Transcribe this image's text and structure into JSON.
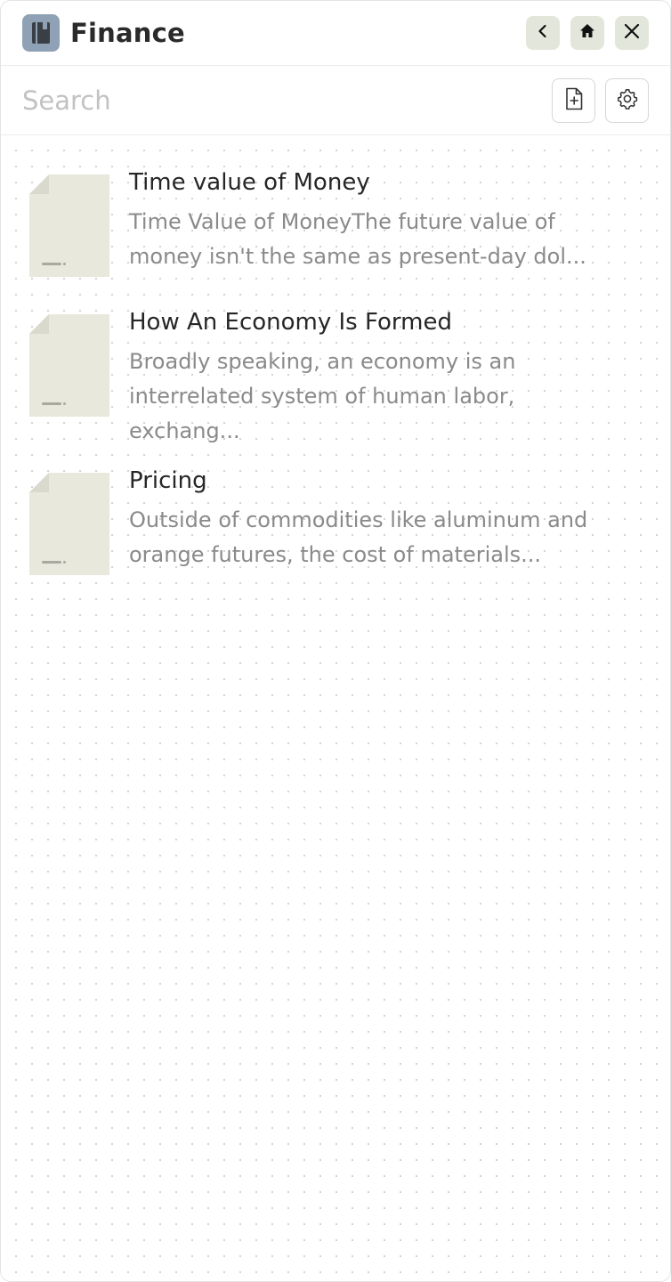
{
  "app": {
    "title": "Finance",
    "icon": "notebook-icon",
    "icon_color": "#8fa1b5"
  },
  "nav": {
    "back_icon": "chevron-left-icon",
    "home_icon": "home-icon",
    "close_icon": "close-icon",
    "button_color": "#e3e6da"
  },
  "search": {
    "placeholder": "Search",
    "value": ""
  },
  "toolbar": {
    "new_note_icon": "new-document-icon",
    "settings_icon": "gear-icon"
  },
  "notes": [
    {
      "title": "Time value of Money",
      "excerpt_lines": [
        "Time Value of MoneyThe future value of",
        "money isn't the same as present-day dol..."
      ]
    },
    {
      "title": "How An Economy Is Formed",
      "excerpt_lines": [
        "Broadly speaking, an economy is an",
        "interrelated system of human labor,",
        "exchang..."
      ]
    },
    {
      "title": "Pricing",
      "excerpt_lines": [
        "Outside of commodities like aluminum and",
        "orange futures, the cost of materials..."
      ]
    }
  ],
  "colors": {
    "thumb_fill": "#e8e8dd",
    "thumb_fold": "#d9d9cd",
    "thumb_bar": "#a9a99f"
  }
}
